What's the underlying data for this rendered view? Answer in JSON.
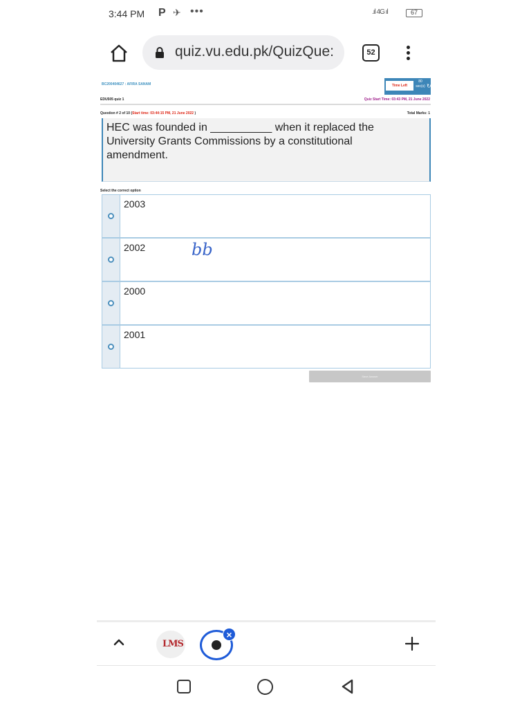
{
  "status_bar": {
    "time": "3:44 PM",
    "notification_icons": [
      "P",
      "✈",
      "•••"
    ],
    "signal": ".ıl 4G ıl",
    "battery": "67"
  },
  "browser": {
    "url": "quiz.vu.edu.pk/QuizQue:",
    "tab_count": "52"
  },
  "quiz": {
    "student_id": "BC200404627 : AFIRA SANAM",
    "time_left_label": "Time Left",
    "time_left_value": "80 sec(s)",
    "course": "EDU505 quiz 1",
    "quiz_start_time": "Quiz Start Time: 03:43 PM, 21 June 2022",
    "question_no": "Question # 2 of 10 (",
    "start_time": "Start time: 03:44:15 PM, 21 June 2022",
    "question_no_close": " )",
    "total_marks": "Total Marks: 1",
    "question_text": "HEC was founded in __________ when it replaced the University Grants Commissions by a constitutional amendment.",
    "select_label": "Select the correct option",
    "options": [
      {
        "label": "2003"
      },
      {
        "label": "2002"
      },
      {
        "label": "2000"
      },
      {
        "label": "2001"
      }
    ],
    "handwritten_mark": "bb",
    "save_button": "Save Answer"
  },
  "toolbar": {
    "lms_tab_label": "LMS"
  },
  "colors": {
    "accent_blue": "#3d86b8",
    "tab_blue": "#1e5bd8",
    "time_red": "#dd2211",
    "quiz_start_purple": "#a0208c"
  }
}
